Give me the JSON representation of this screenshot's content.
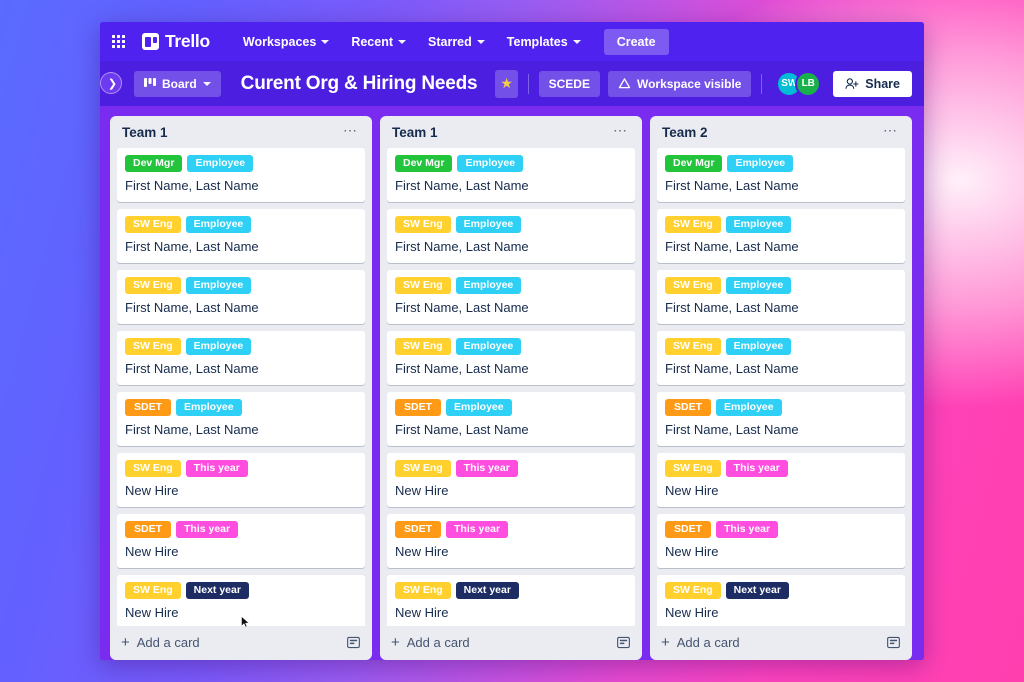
{
  "top_nav": {
    "apps_icon": "grid-apps-icon",
    "brand": "Trello",
    "items": [
      {
        "label": "Workspaces",
        "has_chevron": true
      },
      {
        "label": "Recent",
        "has_chevron": true
      },
      {
        "label": "Starred",
        "has_chevron": true
      },
      {
        "label": "Templates",
        "has_chevron": true
      }
    ],
    "create_label": "Create"
  },
  "board_header": {
    "sidebar_toggle_icon": "chevron-right-icon",
    "board_button_label": "Board",
    "board_button_icon": "board-view-icon",
    "title": "Curent Org & Hiring Needs",
    "star_icon": "star-icon",
    "workspace_tag": "SCEDE",
    "visibility_label": "Workspace visible",
    "visibility_icon": "workspace-visible-icon",
    "members": [
      {
        "initials": "SW",
        "color": "#00bcd4"
      },
      {
        "initials": "LB",
        "color": "#18b04a"
      }
    ],
    "share_label": "Share",
    "share_icon": "add-person-icon"
  },
  "label_colors": {
    "dev_mgr": "#22c43c",
    "sw_eng": "#ffd02e",
    "sdet": "#ff9a16",
    "employee": "#2fd0f5",
    "this_year": "#ff4de0",
    "next_year": "#1d2d63"
  },
  "lists": [
    {
      "title": "Team 1",
      "menu_icon": "list-actions-icon",
      "add_card_label": "Add a card",
      "add_card_icon": "plus-icon",
      "template_icon": "card-template-icon",
      "cards": [
        {
          "labels": [
            {
              "text": "Dev Mgr",
              "color": "#22c43c"
            },
            {
              "text": "Employee",
              "color": "#2fd0f5"
            }
          ],
          "title": "First Name, Last Name"
        },
        {
          "labels": [
            {
              "text": "SW Eng",
              "color": "#ffd02e"
            },
            {
              "text": "Employee",
              "color": "#2fd0f5"
            }
          ],
          "title": "First Name, Last Name"
        },
        {
          "labels": [
            {
              "text": "SW Eng",
              "color": "#ffd02e"
            },
            {
              "text": "Employee",
              "color": "#2fd0f5"
            }
          ],
          "title": "First Name, Last Name"
        },
        {
          "labels": [
            {
              "text": "SW Eng",
              "color": "#ffd02e"
            },
            {
              "text": "Employee",
              "color": "#2fd0f5"
            }
          ],
          "title": "First Name, Last Name"
        },
        {
          "labels": [
            {
              "text": "SDET",
              "color": "#ff9a16"
            },
            {
              "text": "Employee",
              "color": "#2fd0f5"
            }
          ],
          "title": "First Name, Last Name"
        },
        {
          "labels": [
            {
              "text": "SW Eng",
              "color": "#ffd02e"
            },
            {
              "text": "This year",
              "color": "#ff4de0"
            }
          ],
          "title": "New Hire"
        },
        {
          "labels": [
            {
              "text": "SDET",
              "color": "#ff9a16"
            },
            {
              "text": "This year",
              "color": "#ff4de0"
            }
          ],
          "title": "New Hire"
        },
        {
          "labels": [
            {
              "text": "SW Eng",
              "color": "#ffd02e"
            },
            {
              "text": "Next year",
              "color": "#1d2d63"
            }
          ],
          "title": "New Hire"
        }
      ]
    },
    {
      "title": "Team 1",
      "menu_icon": "list-actions-icon",
      "add_card_label": "Add a card",
      "add_card_icon": "plus-icon",
      "template_icon": "card-template-icon",
      "cards": [
        {
          "labels": [
            {
              "text": "Dev Mgr",
              "color": "#22c43c"
            },
            {
              "text": "Employee",
              "color": "#2fd0f5"
            }
          ],
          "title": "First Name, Last Name"
        },
        {
          "labels": [
            {
              "text": "SW Eng",
              "color": "#ffd02e"
            },
            {
              "text": "Employee",
              "color": "#2fd0f5"
            }
          ],
          "title": "First Name, Last Name"
        },
        {
          "labels": [
            {
              "text": "SW Eng",
              "color": "#ffd02e"
            },
            {
              "text": "Employee",
              "color": "#2fd0f5"
            }
          ],
          "title": "First Name, Last Name"
        },
        {
          "labels": [
            {
              "text": "SW Eng",
              "color": "#ffd02e"
            },
            {
              "text": "Employee",
              "color": "#2fd0f5"
            }
          ],
          "title": "First Name, Last Name"
        },
        {
          "labels": [
            {
              "text": "SDET",
              "color": "#ff9a16"
            },
            {
              "text": "Employee",
              "color": "#2fd0f5"
            }
          ],
          "title": "First Name, Last Name"
        },
        {
          "labels": [
            {
              "text": "SW Eng",
              "color": "#ffd02e"
            },
            {
              "text": "This year",
              "color": "#ff4de0"
            }
          ],
          "title": "New Hire"
        },
        {
          "labels": [
            {
              "text": "SDET",
              "color": "#ff9a16"
            },
            {
              "text": "This year",
              "color": "#ff4de0"
            }
          ],
          "title": "New Hire"
        },
        {
          "labels": [
            {
              "text": "SW Eng",
              "color": "#ffd02e"
            },
            {
              "text": "Next year",
              "color": "#1d2d63"
            }
          ],
          "title": "New Hire"
        }
      ]
    },
    {
      "title": "Team 2",
      "menu_icon": "list-actions-icon",
      "add_card_label": "Add a card",
      "add_card_icon": "plus-icon",
      "template_icon": "card-template-icon",
      "cards": [
        {
          "labels": [
            {
              "text": "Dev Mgr",
              "color": "#22c43c"
            },
            {
              "text": "Employee",
              "color": "#2fd0f5"
            }
          ],
          "title": "First Name, Last Name"
        },
        {
          "labels": [
            {
              "text": "SW Eng",
              "color": "#ffd02e"
            },
            {
              "text": "Employee",
              "color": "#2fd0f5"
            }
          ],
          "title": "First Name, Last Name"
        },
        {
          "labels": [
            {
              "text": "SW Eng",
              "color": "#ffd02e"
            },
            {
              "text": "Employee",
              "color": "#2fd0f5"
            }
          ],
          "title": "First Name, Last Name"
        },
        {
          "labels": [
            {
              "text": "SW Eng",
              "color": "#ffd02e"
            },
            {
              "text": "Employee",
              "color": "#2fd0f5"
            }
          ],
          "title": "First Name, Last Name"
        },
        {
          "labels": [
            {
              "text": "SDET",
              "color": "#ff9a16"
            },
            {
              "text": "Employee",
              "color": "#2fd0f5"
            }
          ],
          "title": "First Name, Last Name"
        },
        {
          "labels": [
            {
              "text": "SW Eng",
              "color": "#ffd02e"
            },
            {
              "text": "This year",
              "color": "#ff4de0"
            }
          ],
          "title": "New Hire"
        },
        {
          "labels": [
            {
              "text": "SDET",
              "color": "#ff9a16"
            },
            {
              "text": "This year",
              "color": "#ff4de0"
            }
          ],
          "title": "New Hire"
        },
        {
          "labels": [
            {
              "text": "SW Eng",
              "color": "#ffd02e"
            },
            {
              "text": "Next year",
              "color": "#1d2d63"
            }
          ],
          "title": "New Hire"
        }
      ]
    }
  ]
}
